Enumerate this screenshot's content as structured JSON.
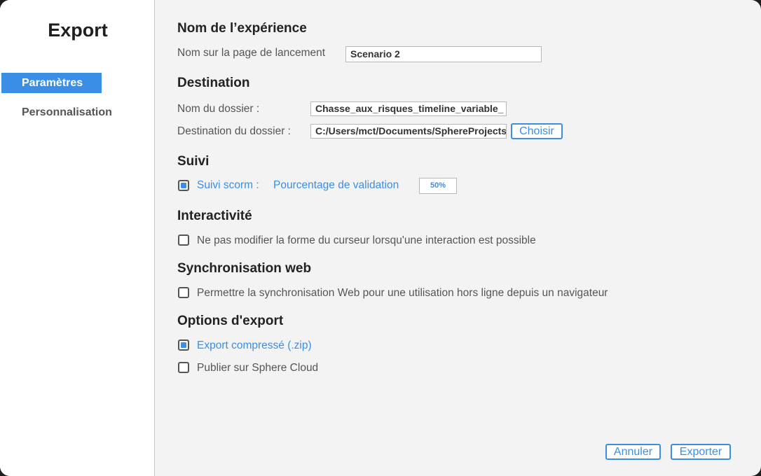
{
  "sidebar": {
    "title": "Export",
    "items": [
      {
        "label": "Paramètres",
        "active": true
      },
      {
        "label": "Personnalisation",
        "active": false
      }
    ]
  },
  "experience": {
    "title": "Nom de l’expérience",
    "launch_label": "Nom sur la page de lancement",
    "launch_value": "Scenario 2"
  },
  "destination": {
    "title": "Destination",
    "folder_name_label": "Nom du dossier :",
    "folder_name_value": "Chasse_aux_risques_timeline_variable_",
    "folder_dest_label": "Destination du dossier :",
    "folder_dest_value": "C:/Users/mct/Documents/SphereProjects",
    "choose_button": "Choisir"
  },
  "tracking": {
    "title": "Suivi",
    "scorm_label": "Suivi scorm :",
    "scorm_checked": true,
    "validation_label": "Pourcentage de validation",
    "validation_value": "50%"
  },
  "interactivity": {
    "title": "Interactivité",
    "cursor_label": "Ne pas modifier la forme du curseur lorsqu'une interaction est possible",
    "cursor_checked": false
  },
  "sync": {
    "title": "Synchronisation web",
    "sync_label": "Permettre la synchronisation Web pour une utilisation hors ligne depuis un navigateur",
    "sync_checked": false
  },
  "options": {
    "title": "Options d'export",
    "zip_label": "Export compressé (.zip)",
    "zip_checked": true,
    "cloud_label": "Publier sur Sphere Cloud",
    "cloud_checked": false
  },
  "footer": {
    "cancel_button": "Annuler",
    "export_button": "Exporter"
  },
  "colors": {
    "accent": "#3a8ee6",
    "panel_background": "#f3f3f3",
    "sidebar_background": "#ffffff"
  }
}
